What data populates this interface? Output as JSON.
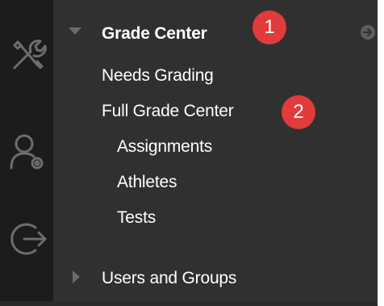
{
  "icons": {
    "tools": "tools-icon",
    "user": "user-settings-icon",
    "exit": "exit-icon",
    "navigate": "arrow-right-circle-icon"
  },
  "menu": {
    "grade_center": {
      "label": "Grade Center",
      "badge": "1",
      "items": [
        {
          "label": "Needs Grading"
        },
        {
          "label": "Full Grade Center",
          "badge": "2"
        },
        {
          "label": "Assignments"
        },
        {
          "label": "Athletes"
        },
        {
          "label": "Tests"
        }
      ]
    },
    "users_groups": {
      "label": "Users and Groups"
    }
  },
  "colors": {
    "panel_bg": "#303030",
    "iconbar_bg": "#1c1c1c",
    "badge": "#e23b3b",
    "text": "#ffffff"
  }
}
